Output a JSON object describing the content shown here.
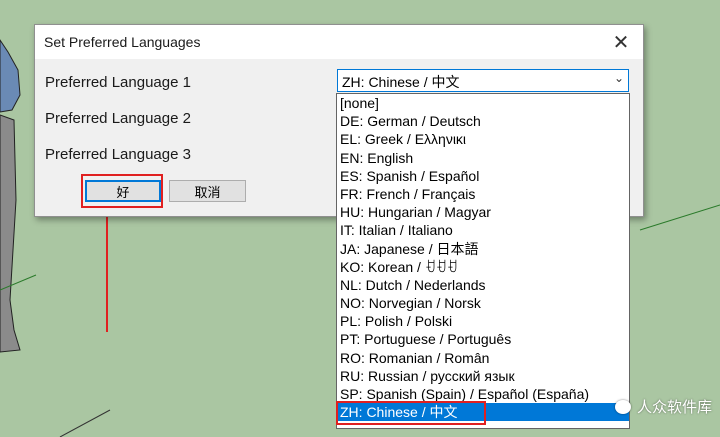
{
  "dialog": {
    "title": "Set Preferred Languages",
    "close_glyph": "✕",
    "labels": [
      "Preferred Language 1",
      "Preferred Language 2",
      "Preferred Language 3"
    ],
    "combo_value": "ZH: Chinese / 中文",
    "combo_arrow": "⌄",
    "ok_label": "好",
    "cancel_label": "取消"
  },
  "dropdown": {
    "options": [
      "[none]",
      "DE: German / Deutsch",
      "EL: Greek / Ελληνικι",
      "EN: English",
      "ES: Spanish / Español",
      "FR: French / Français",
      "HU: Hungarian / Magyar",
      "IT: Italian / Italiano",
      "JA: Japanese / 日本語",
      "KO: Korean / ꀀꀀꀀ",
      "NL: Dutch / Nederlands",
      "NO: Norvegian / Norsk",
      "PL: Polish / Polski",
      "PT: Portuguese / Português",
      "RO: Romanian / Român",
      "RU: Russian / русский язык",
      "SP: Spanish (Spain) / Español (España)",
      "ZH: Chinese / 中文"
    ],
    "selected_index": 17
  },
  "watermark": {
    "text": "人众软件库"
  },
  "colors": {
    "accent": "#0078d7",
    "annotation": "#e02020",
    "background": "#aac6a2"
  }
}
